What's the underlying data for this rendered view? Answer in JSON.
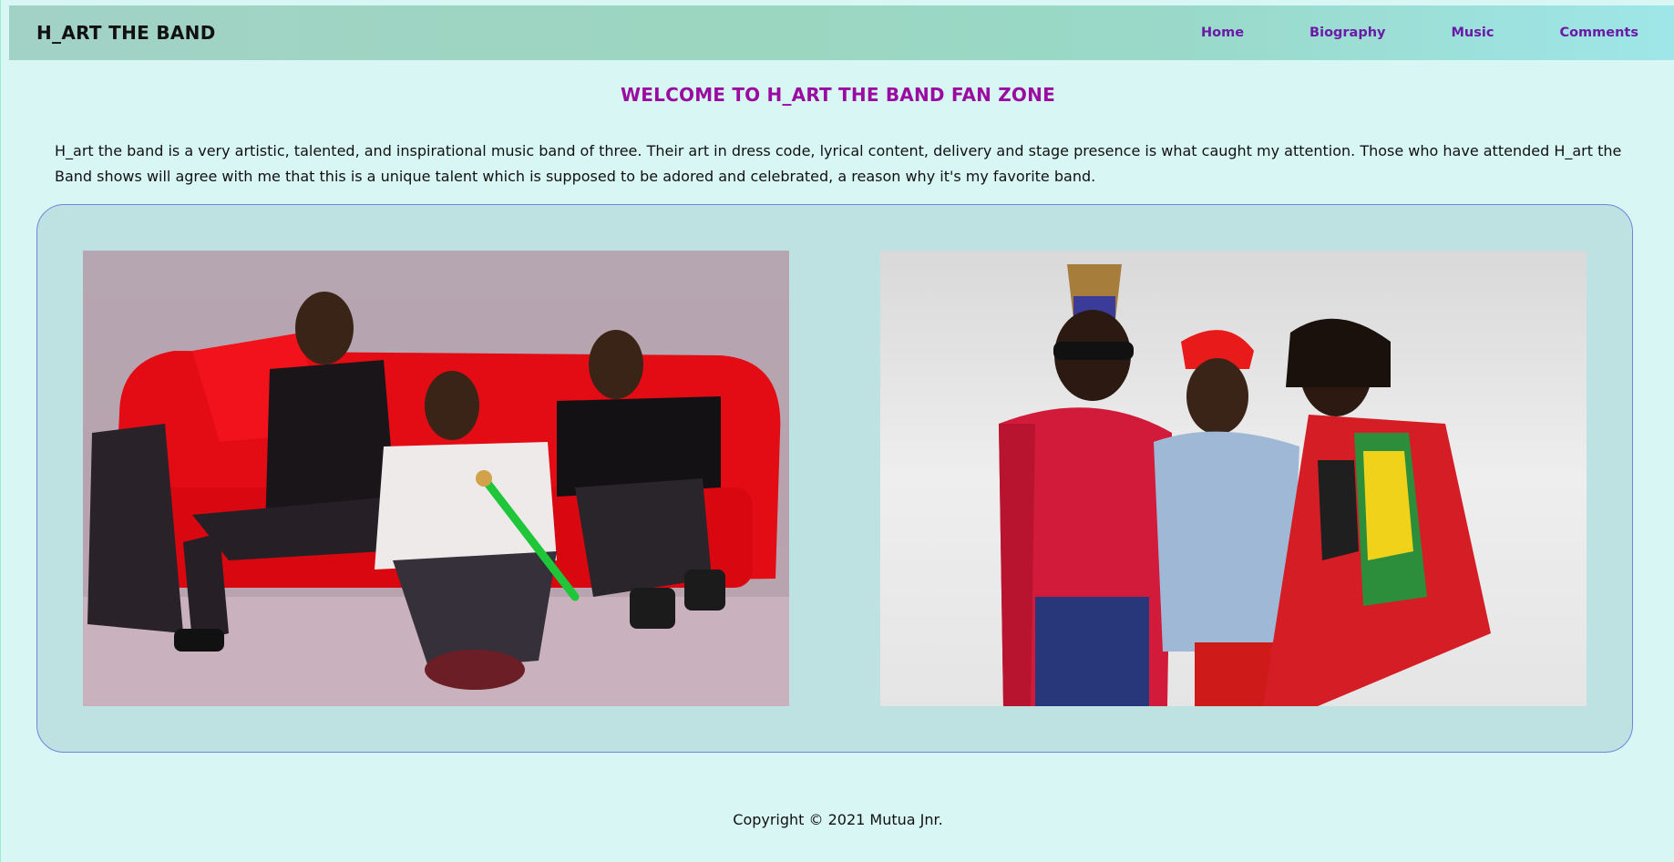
{
  "navbar": {
    "brand": "H_ART THE BAND",
    "links": [
      {
        "label": "Home"
      },
      {
        "label": "Biography"
      },
      {
        "label": "Music"
      },
      {
        "label": "Comments"
      }
    ]
  },
  "main": {
    "heading": "WELCOME TO H_ART THE BAND FAN ZONE",
    "intro": "H_art the band is a very artistic, talented, and inspirational music band of three. Their art in dress code, lyrical content, delivery and stage presence is what caught my attention. Those who have attended H_art the Band shows will agree with me that this is a unique talent which is supposed to be adored and celebrated, a reason why it's my favorite band."
  },
  "footer": {
    "copyright": "Copyright © 2021 Mutua Jnr."
  },
  "colors": {
    "background": "#d8f6f3",
    "nav_link": "#6a1aa6",
    "heading": "#9a0ca0",
    "gallery_bg": "#bde2e1",
    "gallery_border": "#6f86e0"
  }
}
